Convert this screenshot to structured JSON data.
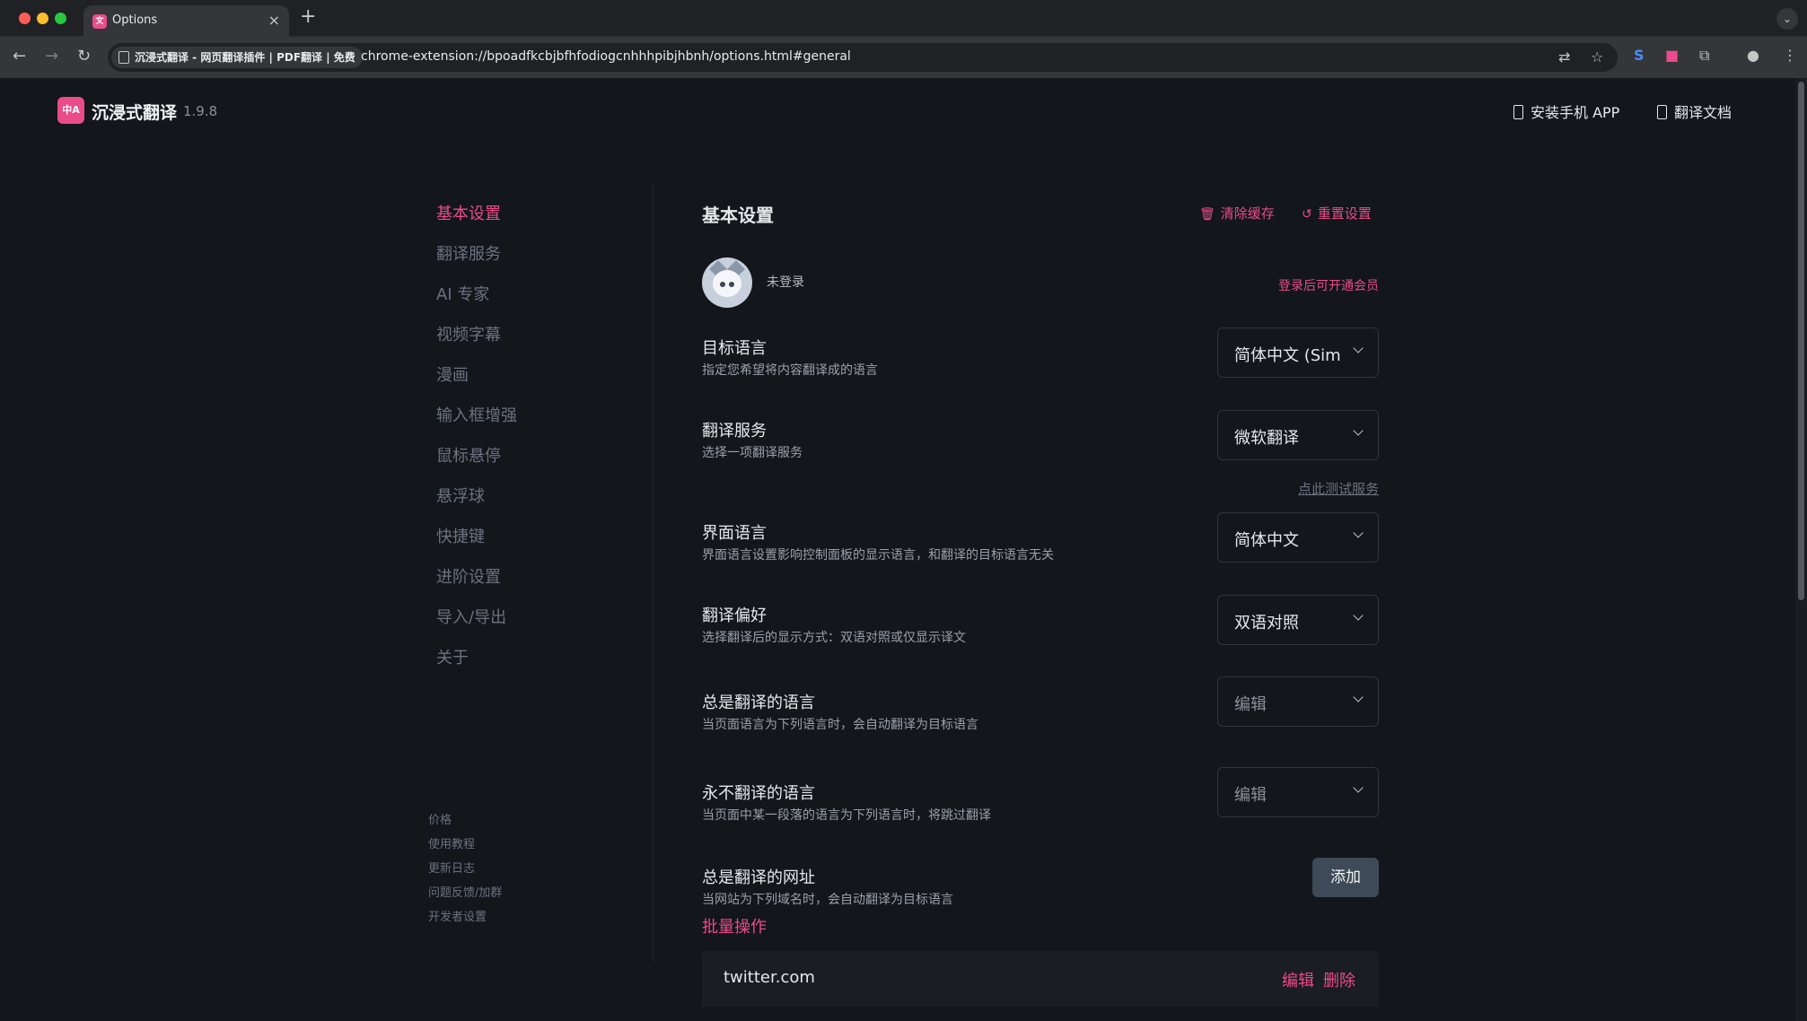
{
  "browser": {
    "tab_title": "Options",
    "site_chip": "沉浸式翻译 - 网页翻译插件 | PDF翻译 | 免费",
    "url": "chrome-extension://bpoadfkcbjbfhfodiogcnhhhpibjhbnh/options.html#general"
  },
  "header": {
    "logo_text": "中A",
    "app_name": "沉浸式翻译",
    "version": "1.9.8",
    "install_app": "安装手机 APP",
    "docs": "翻译文档"
  },
  "sidebar": {
    "items": [
      {
        "label": "基本设置"
      },
      {
        "label": "翻译服务"
      },
      {
        "label": "AI 专家"
      },
      {
        "label": "视频字幕"
      },
      {
        "label": "漫画"
      },
      {
        "label": "输入框增强"
      },
      {
        "label": "鼠标悬停"
      },
      {
        "label": "悬浮球"
      },
      {
        "label": "快捷键"
      },
      {
        "label": "进阶设置"
      },
      {
        "label": "导入/导出"
      },
      {
        "label": "关于"
      }
    ],
    "footer": [
      {
        "label": "价格"
      },
      {
        "label": "使用教程"
      },
      {
        "label": "更新日志"
      },
      {
        "label": "问题反馈/加群"
      },
      {
        "label": "开发者设置"
      }
    ]
  },
  "main": {
    "title": "基本设置",
    "clear_cache": "清除缓存",
    "reset": "重置设置",
    "login_status": "未登录",
    "login_hint": "登录后可开通会员",
    "settings": {
      "target_lang": {
        "label": "目标语言",
        "desc": "指定您希望将内容翻译成的语言",
        "value": "简体中文 (Simp"
      },
      "service": {
        "label": "翻译服务",
        "desc": "选择一项翻译服务",
        "value": "微软翻译",
        "test_link": "点此测试服务"
      },
      "ui_lang": {
        "label": "界面语言",
        "desc": "界面语言设置影响控制面板的显示语言，和翻译的目标语言无关",
        "value": "简体中文"
      },
      "preference": {
        "label": "翻译偏好",
        "desc": "选择翻译后的显示方式：双语对照或仅显示译文",
        "value": "双语对照"
      },
      "always_lang": {
        "label": "总是翻译的语言",
        "desc": "当页面语言为下列语言时，会自动翻译为目标语言",
        "value": "编辑"
      },
      "never_lang": {
        "label": "永不翻译的语言",
        "desc": "当页面中某一段落的语言为下列语言时，将跳过翻译",
        "value": "编辑"
      },
      "always_url": {
        "label": "总是翻译的网址",
        "desc": "当网站为下列域名时，会自动翻译为目标语言",
        "add_label": "添加"
      }
    },
    "batch": "批量操作",
    "url_rows": [
      {
        "domain": "twitter.com",
        "edit": "编辑",
        "delete": "删除"
      }
    ]
  }
}
